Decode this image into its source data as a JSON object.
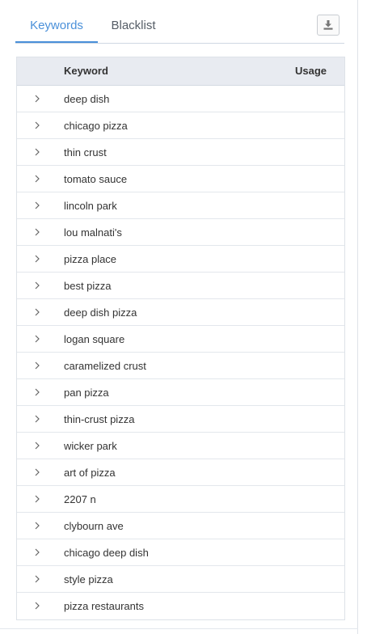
{
  "tabs": {
    "keywords": "Keywords",
    "blacklist": "Blacklist",
    "active": "Keywords"
  },
  "toolbar": {
    "download_icon": "download-icon"
  },
  "table": {
    "headers": {
      "keyword": "Keyword",
      "usage": "Usage"
    },
    "rows": [
      {
        "keyword": "deep dish"
      },
      {
        "keyword": "chicago pizza"
      },
      {
        "keyword": "thin crust"
      },
      {
        "keyword": "tomato sauce"
      },
      {
        "keyword": "lincoln park"
      },
      {
        "keyword": "lou malnati's"
      },
      {
        "keyword": "pizza place"
      },
      {
        "keyword": "best pizza"
      },
      {
        "keyword": "deep dish pizza"
      },
      {
        "keyword": "logan square"
      },
      {
        "keyword": "caramelized crust"
      },
      {
        "keyword": "pan pizza"
      },
      {
        "keyword": "thin-crust pizza"
      },
      {
        "keyword": "wicker park"
      },
      {
        "keyword": "art of pizza"
      },
      {
        "keyword": "2207 n"
      },
      {
        "keyword": "clybourn ave"
      },
      {
        "keyword": "chicago deep dish"
      },
      {
        "keyword": "style pizza"
      },
      {
        "keyword": "pizza restaurants"
      }
    ]
  },
  "colors": {
    "accent": "#4a90d9",
    "header_bg": "#e8ebf1",
    "border": "#dde2e8"
  }
}
